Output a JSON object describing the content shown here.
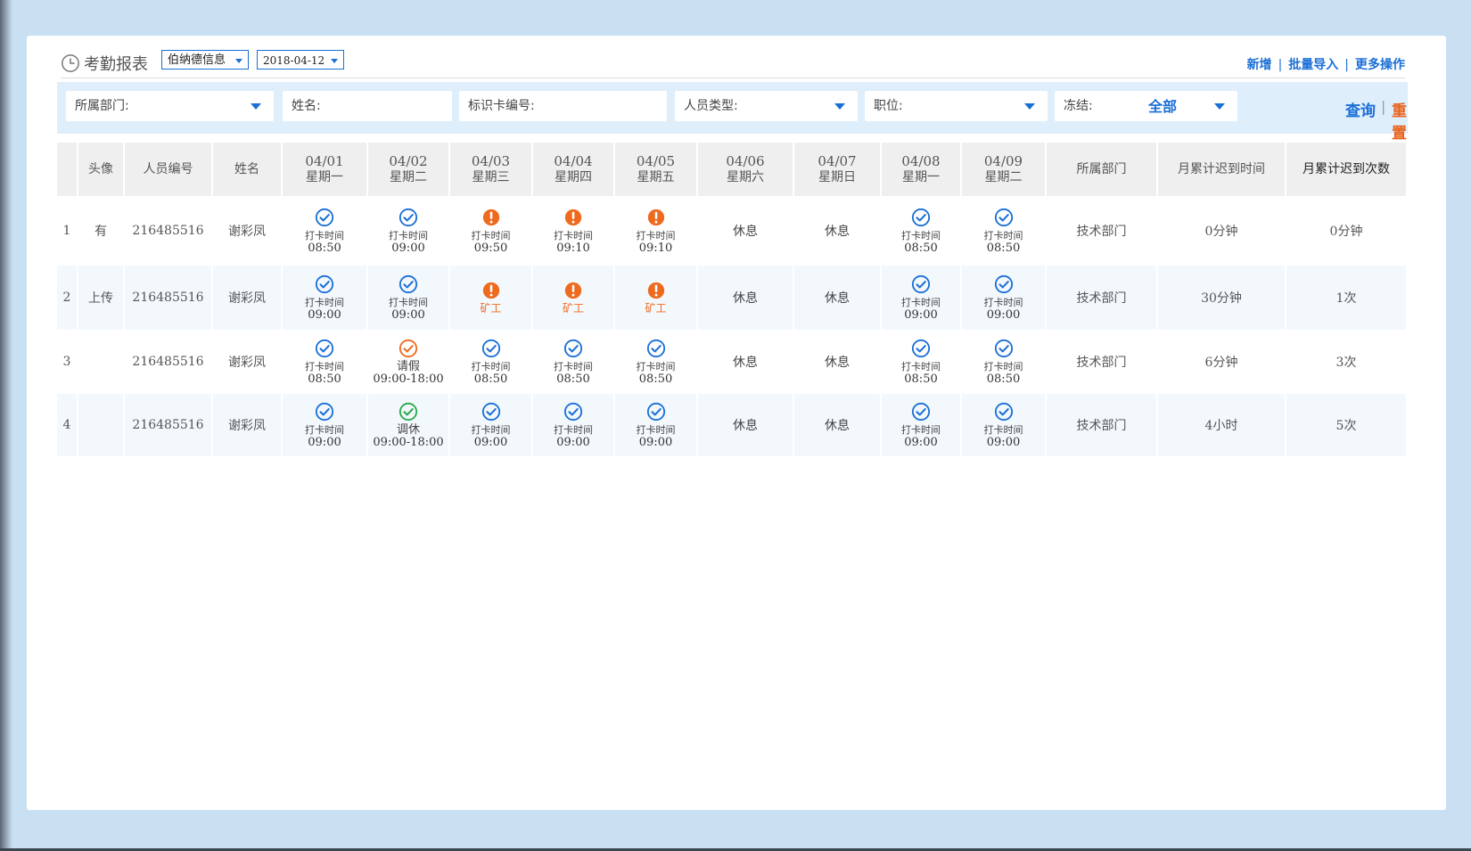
{
  "header": {
    "title": "考勤报表",
    "company": "伯纳德信息",
    "date": "2018-04-12",
    "actions": [
      "新增",
      "批量导入",
      "更多操作"
    ]
  },
  "filters": {
    "dept": "所属部门:",
    "name": "姓名:",
    "card": "标识卡编号:",
    "type": "人员类型:",
    "position": "职位:",
    "frozen_label": "冻结:",
    "frozen_value": "全部",
    "query": "查询",
    "reset": "重置"
  },
  "columns": {
    "avatar": "头像",
    "emp_no": "人员编号",
    "name": "姓名",
    "days": [
      {
        "date": "04/01",
        "week": "星期一"
      },
      {
        "date": "04/02",
        "week": "星期二"
      },
      {
        "date": "04/03",
        "week": "星期三"
      },
      {
        "date": "04/04",
        "week": "星期四"
      },
      {
        "date": "04/05",
        "week": "星期五"
      },
      {
        "date": "04/06",
        "week": "星期六"
      },
      {
        "date": "04/07",
        "week": "星期日"
      },
      {
        "date": "04/08",
        "week": "星期一"
      },
      {
        "date": "04/09",
        "week": "星期二"
      }
    ],
    "dept": "所属部门",
    "late_time": "月累计迟到时间",
    "late_count": "月累计迟到次数"
  },
  "rows": [
    {
      "idx": "1",
      "avatar": "有",
      "emp_no": "216485516",
      "name": "谢彩凤",
      "cells": [
        {
          "kind": "ok",
          "label": "打卡时间",
          "time": "08:50"
        },
        {
          "kind": "ok",
          "label": "打卡时间",
          "time": "09:00"
        },
        {
          "kind": "warn",
          "label": "打卡时间",
          "time": "09:50"
        },
        {
          "kind": "warn",
          "label": "打卡时间",
          "time": "09:10"
        },
        {
          "kind": "warn",
          "label": "打卡时间",
          "time": "09:10"
        },
        {
          "kind": "rest",
          "label": "休息"
        },
        {
          "kind": "rest",
          "label": "休息"
        },
        {
          "kind": "ok",
          "label": "打卡时间",
          "time": "08:50"
        },
        {
          "kind": "ok",
          "label": "打卡时间",
          "time": "08:50"
        }
      ],
      "dept": "技术部门",
      "late_time": "0分钟",
      "late_count": "0分钟",
      "late_color": "normal"
    },
    {
      "idx": "2",
      "avatar": "上传",
      "emp_no": "216485516",
      "name": "谢彩凤",
      "cells": [
        {
          "kind": "ok",
          "label": "打卡时间",
          "time": "09:00"
        },
        {
          "kind": "ok",
          "label": "打卡时间",
          "time": "09:00"
        },
        {
          "kind": "absent",
          "label": "矿工"
        },
        {
          "kind": "absent",
          "label": "矿工"
        },
        {
          "kind": "absent",
          "label": "矿工"
        },
        {
          "kind": "rest",
          "label": "休息"
        },
        {
          "kind": "rest",
          "label": "休息"
        },
        {
          "kind": "ok",
          "label": "打卡时间",
          "time": "09:00"
        },
        {
          "kind": "ok",
          "label": "打卡时间",
          "time": "09:00"
        }
      ],
      "dept": "技术部门",
      "late_time": "30分钟",
      "late_count": "1次",
      "late_color": "orange"
    },
    {
      "idx": "3",
      "avatar": "",
      "emp_no": "216485516",
      "name": "谢彩凤",
      "cells": [
        {
          "kind": "ok",
          "label": "打卡时间",
          "time": "08:50"
        },
        {
          "kind": "leave",
          "label": "请假",
          "time": "09:00-18:00"
        },
        {
          "kind": "ok",
          "label": "打卡时间",
          "time": "08:50"
        },
        {
          "kind": "ok",
          "label": "打卡时间",
          "time": "08:50"
        },
        {
          "kind": "ok",
          "label": "打卡时间",
          "time": "08:50"
        },
        {
          "kind": "rest",
          "label": "休息"
        },
        {
          "kind": "rest",
          "label": "休息"
        },
        {
          "kind": "ok",
          "label": "打卡时间",
          "time": "08:50"
        },
        {
          "kind": "ok",
          "label": "打卡时间",
          "time": "08:50"
        }
      ],
      "dept": "技术部门",
      "late_time": "6分钟",
      "late_count": "3次",
      "late_color": "orange"
    },
    {
      "idx": "4",
      "avatar": "",
      "emp_no": "216485516",
      "name": "谢彩凤",
      "cells": [
        {
          "kind": "ok",
          "label": "打卡时间",
          "time": "09:00"
        },
        {
          "kind": "swap",
          "label": "调休",
          "time": "09:00-18:00"
        },
        {
          "kind": "ok",
          "label": "打卡时间",
          "time": "09:00"
        },
        {
          "kind": "ok",
          "label": "打卡时间",
          "time": "09:00"
        },
        {
          "kind": "ok",
          "label": "打卡时间",
          "time": "09:00"
        },
        {
          "kind": "rest",
          "label": "休息"
        },
        {
          "kind": "rest",
          "label": "休息"
        },
        {
          "kind": "ok",
          "label": "打卡时间",
          "time": "09:00"
        },
        {
          "kind": "ok",
          "label": "打卡时间",
          "time": "09:00"
        }
      ],
      "dept": "技术部门",
      "late_time": "4小时",
      "late_count": "5次",
      "late_color": "orange"
    }
  ],
  "colors": {
    "accent": "#1a6fd6",
    "warning": "#ee6a1e",
    "success": "#2aa84a",
    "filter_bg": "#dfeefb",
    "page_bg": "#c9e0f3"
  },
  "icons": {
    "ok": "check-circle-icon",
    "warn": "exclamation-icon",
    "leave": "check-circle-orange-icon",
    "swap": "check-circle-green-icon",
    "title": "clock-icon"
  }
}
